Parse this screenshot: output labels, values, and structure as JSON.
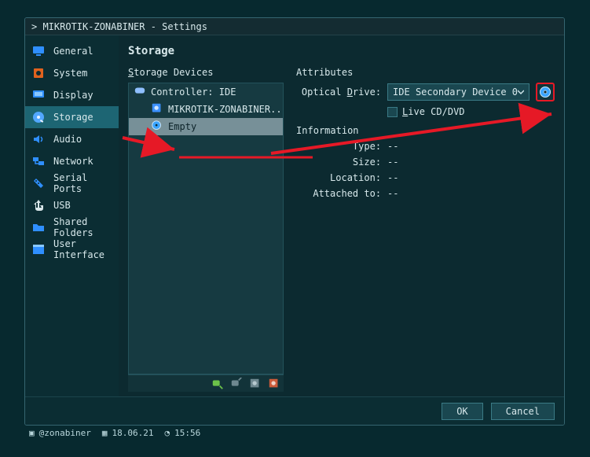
{
  "title": "> MIKROTIK-ZONABINER - Settings",
  "sidebar": {
    "items": [
      {
        "label": "General",
        "icon": "monitor-icon",
        "color": "#2f8fff"
      },
      {
        "label": "System",
        "icon": "chip-icon",
        "color": "#e0621e"
      },
      {
        "label": "Display",
        "icon": "display-icon",
        "color": "#2f8fff"
      },
      {
        "label": "Storage",
        "icon": "hdd-icon",
        "color": "#52a7ff",
        "selected": true
      },
      {
        "label": "Audio",
        "icon": "speaker-icon",
        "color": "#2f8fff"
      },
      {
        "label": "Network",
        "icon": "network-icon",
        "color": "#2f8fff"
      },
      {
        "label": "Serial Ports",
        "icon": "serial-icon",
        "color": "#2f8fff"
      },
      {
        "label": "USB",
        "icon": "usb-icon",
        "color": "#d9e6e9"
      },
      {
        "label": "Shared Folders",
        "icon": "folder-icon",
        "color": "#2f8fff"
      },
      {
        "label": "User Interface",
        "icon": "panel-icon",
        "color": "#2f8fff"
      }
    ]
  },
  "main": {
    "title": "Storage",
    "devices_label": "Storage Devices",
    "attributes_label": "Attributes",
    "tree": [
      {
        "label": "Controller: IDE",
        "icon": "controller-icon",
        "level": 1
      },
      {
        "label": "MIKROTIK-ZONABINER....",
        "icon": "hdd-small-icon",
        "level": 2
      },
      {
        "label": "Empty",
        "icon": "disc-small-icon",
        "level": 2,
        "selected": true
      }
    ],
    "toolbar_icons": [
      "add-controller-icon",
      "remove-controller-icon",
      "add-disk-icon",
      "remove-disk-icon"
    ],
    "attributes": {
      "optical_label": "Optical Drive:",
      "optical_value": "IDE Secondary Device 0",
      "disc_icon": "disc-icon",
      "live_label": "Live CD/DVD"
    },
    "info_label": "Information",
    "info": {
      "type_k": "Type:",
      "type_v": "--",
      "size_k": "Size:",
      "size_v": "--",
      "loc_k": "Location:",
      "loc_v": "--",
      "att_k": "Attached to:",
      "att_v": "--"
    }
  },
  "footer": {
    "ok": "OK",
    "cancel": "Cancel"
  },
  "taskbar": {
    "user": "@zonabiner",
    "date": "18.06.21",
    "time": "15:56"
  }
}
